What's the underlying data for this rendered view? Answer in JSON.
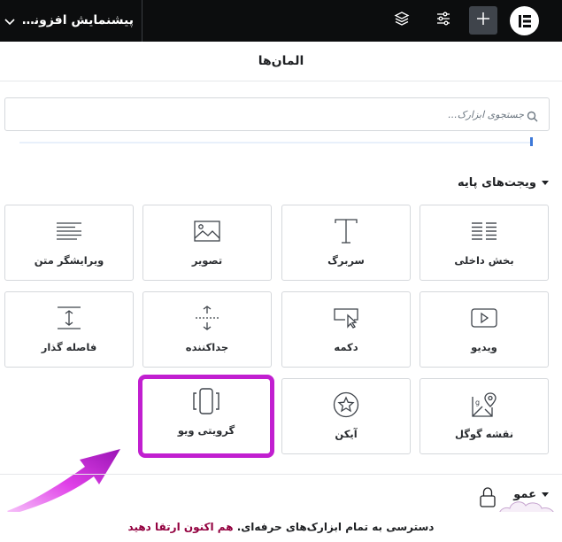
{
  "topbar": {
    "page_title": "پیشنمایش افزونه t...",
    "add_label": "+"
  },
  "panel": {
    "title": "المان‌ها"
  },
  "search": {
    "placeholder": "جستجوی ابزارک..."
  },
  "categories": [
    {
      "title": "ویجت‌های پایه",
      "widgets": [
        {
          "label": "بخش داخلی",
          "icon": "inner-section-icon"
        },
        {
          "label": "سربرگ",
          "icon": "heading-icon"
        },
        {
          "label": "تصویر",
          "icon": "image-icon"
        },
        {
          "label": "ویرایشگر متن",
          "icon": "text-editor-icon"
        },
        {
          "label": "ویدیو",
          "icon": "video-icon"
        },
        {
          "label": "دکمه",
          "icon": "button-icon"
        },
        {
          "label": "جداکننده",
          "icon": "divider-icon"
        },
        {
          "label": "فاصله گذار",
          "icon": "spacer-icon"
        },
        {
          "label": "نقشه گوگل",
          "icon": "google-maps-icon"
        },
        {
          "label": "آیکن",
          "icon": "star-icon"
        },
        {
          "label": "گرویتی ویو",
          "icon": "gravity-view-icon",
          "highlighted": true
        }
      ]
    },
    {
      "title": "عمو"
    }
  ],
  "promo": {
    "text": "دسترسی به تمام ابزارک‌های حرفه‌ای.",
    "link": "هم اکنون ارتقا دهید"
  },
  "colors": {
    "topbar_bg": "#0c0d0e",
    "highlight_border": "#c11fd0",
    "promo_link": "#93003f",
    "arrow": "#e040e8"
  }
}
